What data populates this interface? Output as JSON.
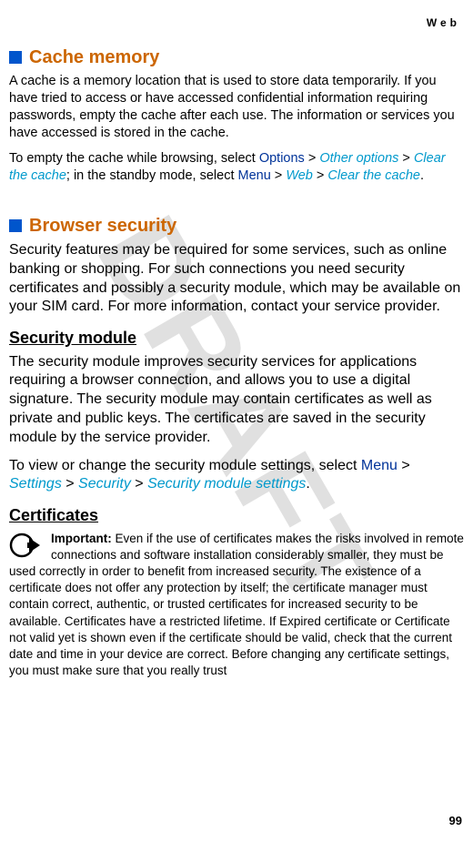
{
  "header": {
    "topic": "Web"
  },
  "watermark": "DRAFT",
  "sections": {
    "cache": {
      "title": "Cache memory",
      "p1": "A cache is a memory location that is used to store data temporarily. If you have tried to access or have accessed confidential information requiring passwords, empty the cache after each use. The information or services you have accessed is stored in the cache.",
      "p2_pre": "To empty the cache while browsing, select ",
      "p2_options": "Options",
      "p2_gt1": " > ",
      "p2_other": "Other options",
      "p2_gt2": " > ",
      "p2_clear": "Clear the cache",
      "p2_mid": "; in the standby mode, select ",
      "p2_menu": "Menu",
      "p2_gt3": " > ",
      "p2_web": "Web",
      "p2_gt4": " > ",
      "p2_clear2": "Clear the cache",
      "p2_end": "."
    },
    "browser": {
      "title": "Browser security",
      "p1": "Security features may be required for some services, such as online banking or shopping. For such connections you need security certificates and possibly a security module, which may be available on your SIM card. For more information, contact your service provider."
    },
    "secmodule": {
      "title": "Security module",
      "p1": "The security module improves security services for applications requiring a browser connection, and allows you to use a digital signature. The security module may contain certificates as well as private and public keys. The certificates are saved in the security module by the service provider.",
      "p2_pre": "To view or change the security module settings, select ",
      "p2_menu": "Menu",
      "p2_gt1": " > ",
      "p2_settings": "Settings",
      "p2_gt2": " > ",
      "p2_security": "Security",
      "p2_gt3": " > ",
      "p2_sms": "Security module settings",
      "p2_end": "."
    },
    "certs": {
      "title": "Certificates",
      "important_label": "Important:",
      "important_text": " Even if the use of certificates makes the risks involved in remote connections and software installation considerably smaller, they must be used correctly in order to benefit from increased security. The existence of a certificate does not offer any protection by itself; the certificate manager must contain correct, authentic, or trusted certificates for increased security to be available. Certificates have a restricted lifetime. If Expired certificate or Certificate not valid yet is shown even if the certificate should be valid, check that the current date and time in your device are correct. Before changing any certificate settings, you must make sure that you really trust"
    }
  },
  "pageNumber": "99"
}
